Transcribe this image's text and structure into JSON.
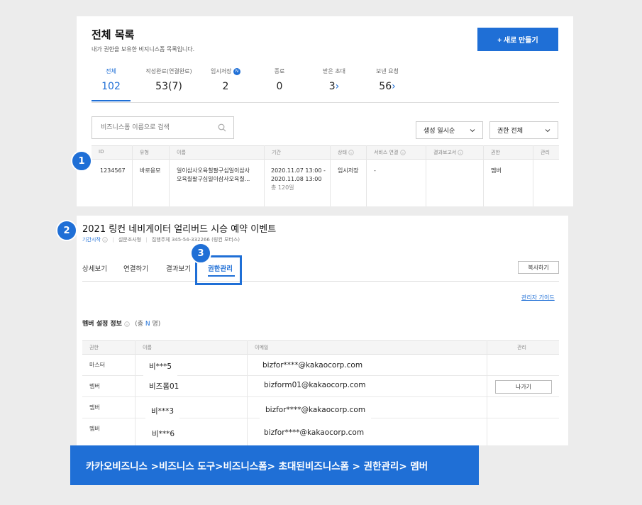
{
  "list": {
    "title": "전체 목록",
    "subtitle": "내가 권한을 보유한 비지니스폼 목록입니다.",
    "new_button": "+ 새로 만들기",
    "tabs": [
      {
        "label": "전체",
        "count": "102"
      },
      {
        "label": "작성완료(연결완료)",
        "count": "53(7)"
      },
      {
        "label": "임시저장",
        "count": "2",
        "badge": "N"
      },
      {
        "label": "종료",
        "count": "0"
      },
      {
        "label": "받은 초대",
        "count": "3",
        "arrow": "›"
      },
      {
        "label": "보낸 요청",
        "count": "56",
        "arrow": "›"
      }
    ],
    "search_placeholder": "비즈니스폼 이름으로 검색",
    "sort_select": "생성 일시순",
    "perm_select": "권한 전체",
    "columns": [
      "ID",
      "유형",
      "이름",
      "기간",
      "상태",
      "서비스 연결",
      "결과보고서",
      "권한",
      "관리"
    ],
    "row": {
      "id": "1234567",
      "type": "바로응모",
      "name_line1": "일이삼사오육칠팔구십일이삼사",
      "name_line2": "오육칠팔구십일이삼사오육칠...",
      "period_line1": "2020.11.07 13:00 -",
      "period_line2": "2020.11.08 13:00",
      "period_total": "총 120일",
      "status": "임시저장",
      "service": "-",
      "permission": "멤버"
    }
  },
  "markers": [
    "1",
    "2",
    "3"
  ],
  "detail": {
    "title": "2021 링컨 네비게이터 얼리버드 시승 예약 이벤트",
    "meta_status": "기간시작",
    "meta_type": "설문조사형",
    "meta_org": "집행주체 345-54-332266 (링컨 모터스)",
    "tabs": [
      "상세보기",
      "연결하기",
      "결과보기",
      "권한관리"
    ],
    "copy_button": "복사하기",
    "admin_guide": "관리자 가이드",
    "member_title": "멤버 설정 정보",
    "member_count_prefix": "(총 ",
    "member_count_n": "N",
    "member_count_suffix": " 명)",
    "columns": [
      "권한",
      "이름",
      "이메일",
      "관리"
    ],
    "members": [
      {
        "role": "마스터",
        "name": "비***5",
        "email": "bizfor****@kakaocorp.com",
        "action": ""
      },
      {
        "role": "멤버",
        "name": "비즈폼01",
        "email": "bizform01@kakaocorp.com",
        "action": "나가기"
      },
      {
        "role": "멤버",
        "name": "비***3",
        "email": "bizfor****@kakaocorp.com",
        "action": ""
      },
      {
        "role": "멤버",
        "name": "비***6",
        "email": "bizfor****@kakaocorp.com",
        "action": ""
      }
    ]
  },
  "banner": "카카오비즈니스 >비즈니스 도구>비즈니스폼> 초대된비즈니스폼 > 권한관리> 멤버",
  "colors": {
    "accent": "#1f6fd6",
    "background": "#ececec"
  }
}
